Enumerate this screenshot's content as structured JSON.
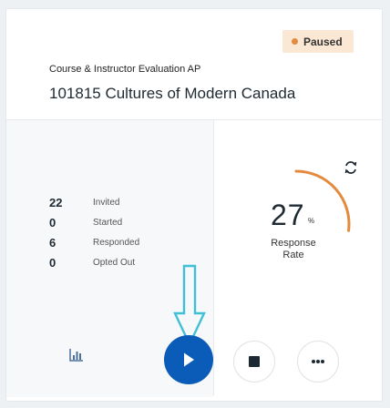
{
  "status": {
    "label": "Paused",
    "color": "#e38a3e"
  },
  "survey": {
    "type_label": "Course & Instructor Evaluation AP",
    "title": "101815 Cultures of Modern Canada"
  },
  "stats": [
    {
      "value": "22",
      "label": "Invited"
    },
    {
      "value": "0",
      "label": "Started"
    },
    {
      "value": "6",
      "label": "Responded"
    },
    {
      "value": "0",
      "label": "Opted Out"
    }
  ],
  "response_rate": {
    "value": "27",
    "unit": "%",
    "label_line1": "Response",
    "label_line2": "Rate",
    "fraction": 0.27,
    "arc_color": "#e38a3e"
  },
  "icons": {
    "refresh": "refresh-icon",
    "chart": "bar-chart-icon",
    "play": "play-icon",
    "stop": "stop-icon",
    "more": "more-icon"
  },
  "colors": {
    "primary": "#0a5cb8",
    "arrow": "#3fc0d6"
  }
}
